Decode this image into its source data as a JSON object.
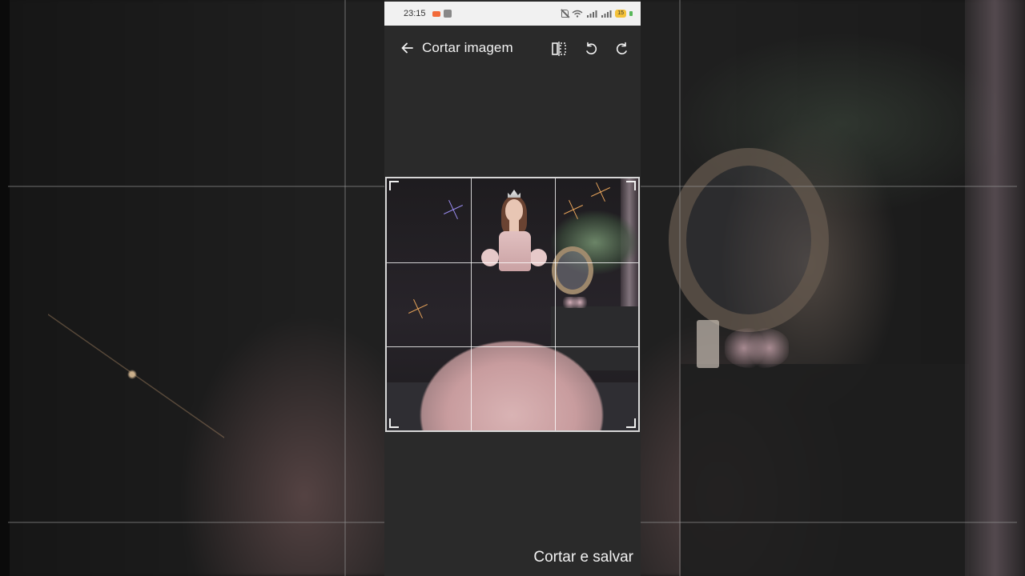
{
  "status_bar": {
    "time": "23:15",
    "battery": "15",
    "icons": [
      "record-icon",
      "youtube-icon",
      "mute-icon",
      "wifi-icon",
      "signal-icon",
      "signal-icon",
      "battery-icon",
      "charging-icon"
    ]
  },
  "app_bar": {
    "title": "Cortar imagem",
    "back_icon": "arrow-left-icon",
    "tools": [
      "flip-icon",
      "rotate-left-icon",
      "rotate-right-icon"
    ]
  },
  "crop": {
    "grid": "3x3"
  },
  "actions": {
    "save_label": "Cortar e salvar"
  }
}
